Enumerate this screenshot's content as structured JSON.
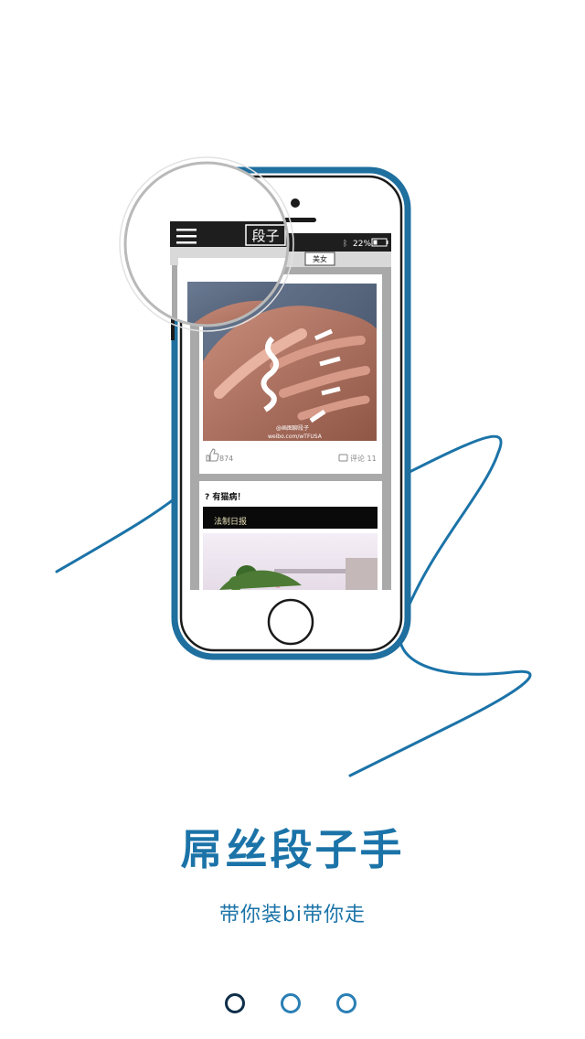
{
  "title": "屌丝段子手",
  "subtitle": "带你装bi带你走",
  "phone_screen": {
    "header_title": "段子",
    "battery_text": "22%",
    "tab_label": "美女",
    "post1": {
      "like_count": "874",
      "comment_label": "评论 11",
      "watermark": "@画图聊段子",
      "watermark_url": "weibo.com/wTFUSA"
    },
    "post2": {
      "title": "? 有猫病！",
      "caption": "法制日报"
    }
  },
  "pager": {
    "pages": 3,
    "active_index": 0
  },
  "colors": {
    "accent": "#1b73a8",
    "phone_frame": "#1f6f9f",
    "status_bar": "#1e1e1e",
    "active_dot": "#0f2e4a"
  },
  "icons": {
    "menu": "hamburger-menu-icon",
    "like": "thumbs-up-icon",
    "comment": "comment-bubble-icon",
    "battery": "battery-icon",
    "bluetooth": "bluetooth-icon",
    "home": "home-button-icon",
    "magnifier": "magnifying-glass-icon"
  }
}
